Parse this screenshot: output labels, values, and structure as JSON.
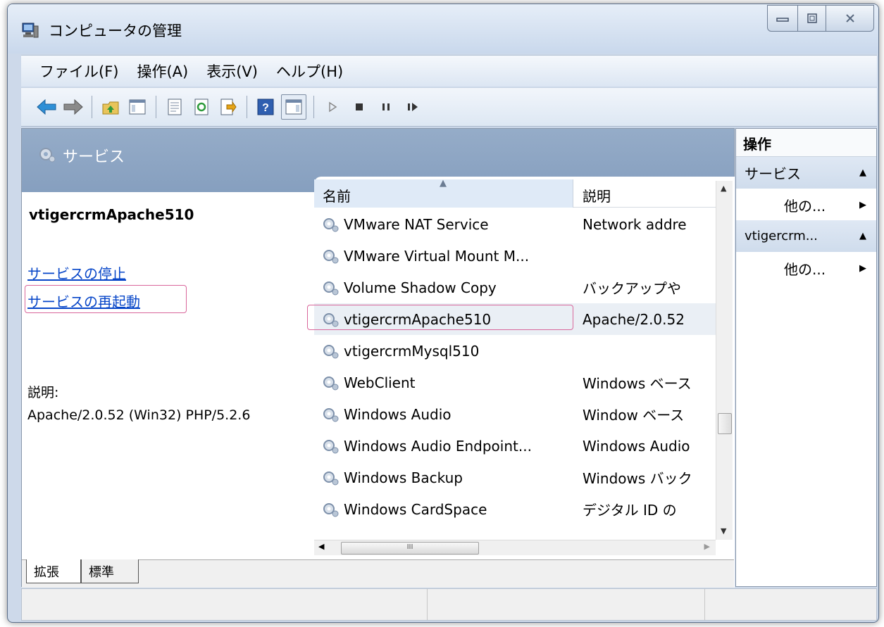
{
  "window": {
    "title": "コンピュータの管理"
  },
  "menu": [
    "ファイル(F)",
    "操作(A)",
    "表示(V)",
    "ヘルプ(H)"
  ],
  "toolbar": {
    "buttons": [
      "back-arrow-icon",
      "forward-arrow-icon",
      "up-folder-icon",
      "show-hide-tree-icon",
      "properties-icon",
      "refresh-icon",
      "export-list-icon",
      "help-icon",
      "show-hide-action-pane-icon",
      "play-icon",
      "stop-icon",
      "pause-icon",
      "restart-icon"
    ]
  },
  "header": {
    "title": "サービス"
  },
  "detail": {
    "service_name": "vtigercrmApache510",
    "stop_link": "サービスの停止",
    "restart_link": "サービスの再起動",
    "description_label": "説明:",
    "description": "Apache/2.0.52 (Win32) PHP/5.2.6"
  },
  "list": {
    "columns": {
      "name": "名前",
      "description": "説明"
    },
    "rows": [
      {
        "name": "VMware NAT Service",
        "description": "Network addre"
      },
      {
        "name": "VMware Virtual Mount M...",
        "description": ""
      },
      {
        "name": "Volume Shadow Copy",
        "description": "バックアップや"
      },
      {
        "name": "vtigercrmApache510",
        "description": "Apache/2.0.52"
      },
      {
        "name": "vtigercrmMysql510",
        "description": ""
      },
      {
        "name": "WebClient",
        "description": "Windows ベース"
      },
      {
        "name": "Windows Audio",
        "description": "Window ベース"
      },
      {
        "name": "Windows Audio Endpoint...",
        "description": "Windows Audio"
      },
      {
        "name": "Windows Backup",
        "description": "Windows バック"
      },
      {
        "name": "Windows CardSpace",
        "description": "デジタル ID の"
      }
    ],
    "hscroll_grip": "III"
  },
  "tabs": [
    "拡張",
    "標準"
  ],
  "actions": {
    "header": "操作",
    "groups": [
      {
        "label": "サービス",
        "item": "他の..."
      },
      {
        "label": "vtigercrm...",
        "item": "他の..."
      }
    ]
  }
}
